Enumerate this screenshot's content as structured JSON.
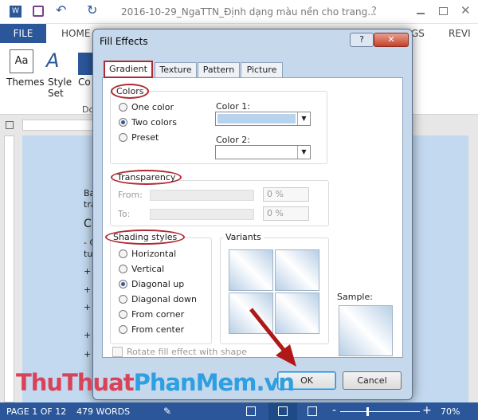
{
  "window": {
    "title": "2016-10-29_NgaTTN_Định dạng màu nền cho trang...",
    "help": "?"
  },
  "ribbon": {
    "tabs": [
      "FILE",
      "HOME",
      "GS",
      "REVI"
    ],
    "themes": "Themes",
    "style_set": "Style Set",
    "colors_partial": "Co",
    "group_partial": "Do"
  },
  "document": {
    "lines": [
      "Ba",
      "tra",
      "C",
      "- C",
      "tu",
      "+",
      "+",
      "+",
      "+",
      "+"
    ]
  },
  "dialog": {
    "title": "Fill Effects",
    "tabs": [
      "Gradient",
      "Texture",
      "Pattern",
      "Picture"
    ],
    "colors": {
      "legend": "Colors",
      "options": [
        "One color",
        "Two colors",
        "Preset"
      ],
      "selected": "Two colors",
      "color1_label": "Color 1:",
      "color2_label": "Color 2:",
      "color1_value": "#b8d3ee"
    },
    "transparency": {
      "legend": "Transparency",
      "from_label": "From:",
      "to_label": "To:",
      "from_value": "0 %",
      "to_value": "0 %"
    },
    "shading": {
      "legend": "Shading styles",
      "options": [
        "Horizontal",
        "Vertical",
        "Diagonal up",
        "Diagonal down",
        "From corner",
        "From center"
      ],
      "selected": "Diagonal up"
    },
    "variants_label": "Variants",
    "sample_label": "Sample:",
    "rotate_label": "Rotate fill effect with shape",
    "ok": "OK",
    "cancel": "Cancel"
  },
  "status": {
    "page": "PAGE 1 OF 12",
    "words": "479 WORDS",
    "zoom": "70%",
    "zoom_level": 70
  },
  "watermark": {
    "part1": "ThuThuat",
    "part2": "PhanMem.vn"
  },
  "colors": {
    "accent": "#2b579a",
    "highlight": "#b02a34"
  }
}
